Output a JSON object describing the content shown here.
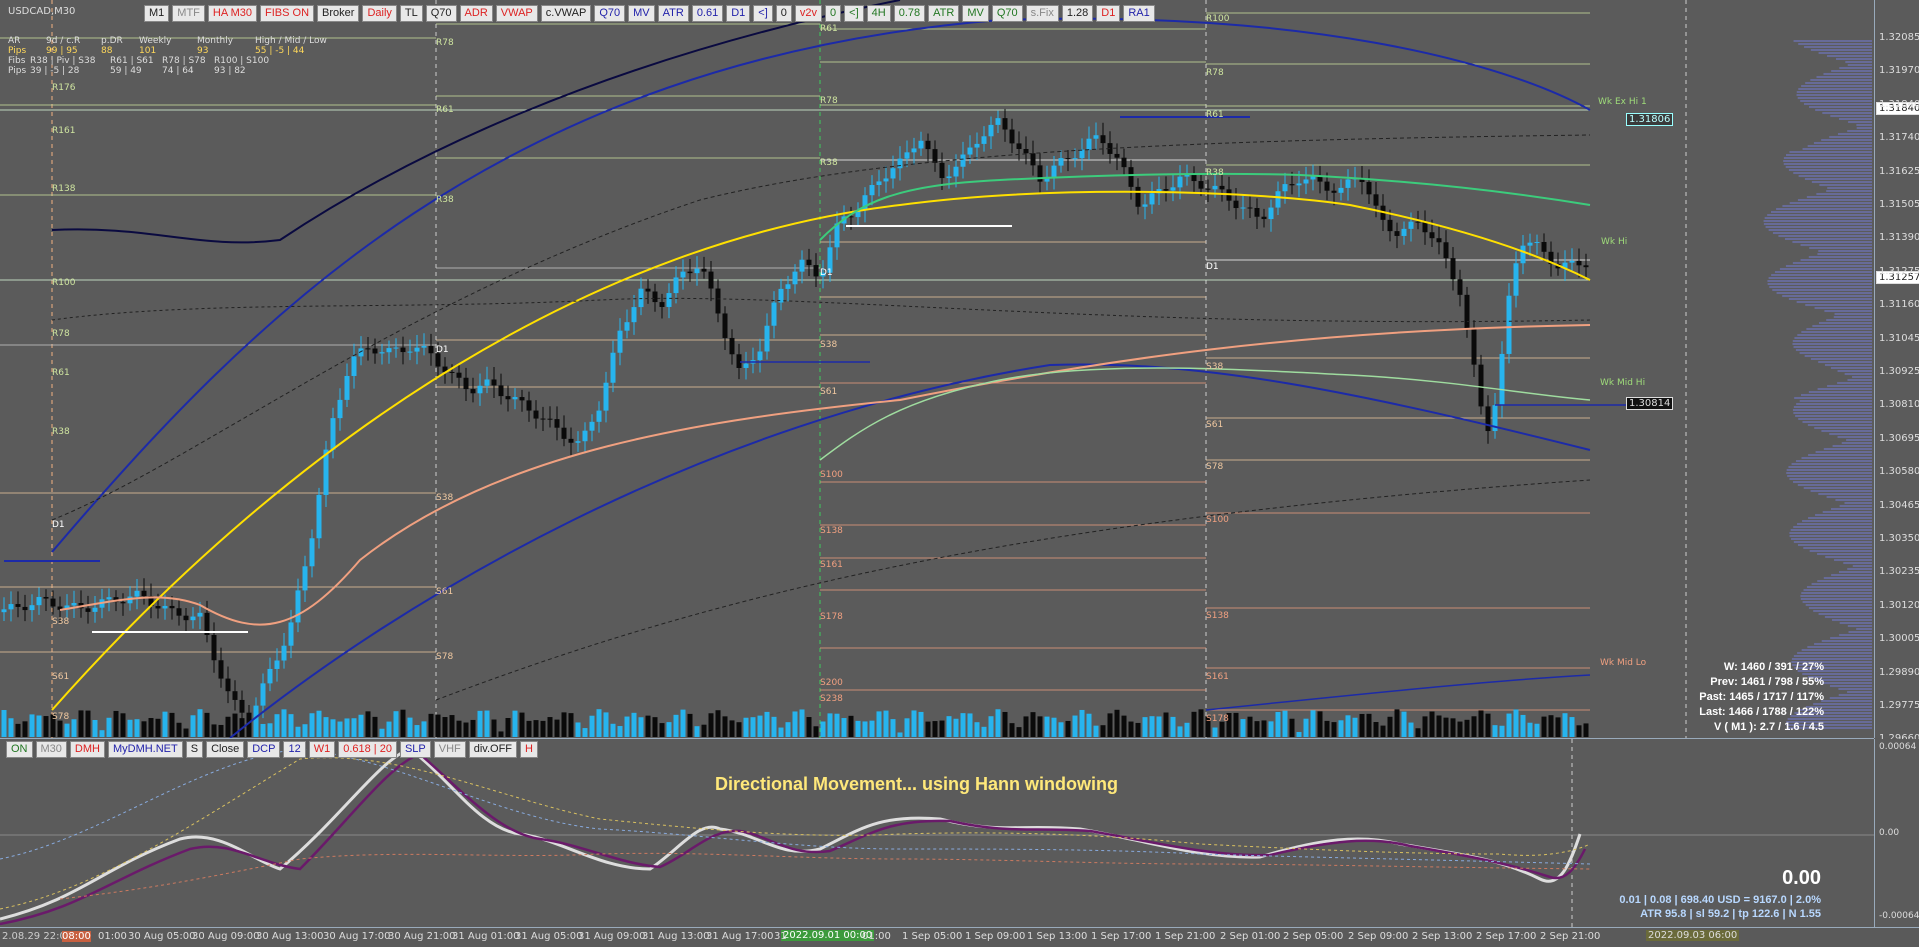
{
  "symbol": "USDCAD,M30",
  "toolbar": [
    {
      "label": "M1",
      "color": "#222"
    },
    {
      "label": "MTF",
      "color": "#888"
    },
    {
      "label": "HA M30",
      "color": "#d22"
    },
    {
      "label": "FIBS ON",
      "color": "#d22"
    },
    {
      "label": "Broker",
      "color": "#222"
    },
    {
      "label": "Daily",
      "color": "#d22"
    },
    {
      "label": "TL",
      "color": "#222"
    },
    {
      "label": "Q70",
      "color": "#222"
    },
    {
      "label": "ADR",
      "color": "#d22"
    },
    {
      "label": "VWAP",
      "color": "#d22"
    },
    {
      "label": "c.VWAP",
      "color": "#222"
    },
    {
      "label": "Q70",
      "color": "#22a"
    },
    {
      "label": "MV",
      "color": "#22a"
    },
    {
      "label": "ATR",
      "color": "#22a"
    },
    {
      "label": "0.61",
      "color": "#22a"
    },
    {
      "label": "D1",
      "color": "#22a"
    },
    {
      "label": "<]",
      "color": "#22a"
    },
    {
      "label": "0",
      "color": "#222"
    },
    {
      "label": "v2v",
      "color": "#d22"
    },
    {
      "label": "0",
      "color": "#272"
    },
    {
      "label": "<]",
      "color": "#272"
    },
    {
      "label": "4H",
      "color": "#272"
    },
    {
      "label": "0.78",
      "color": "#272"
    },
    {
      "label": "ATR",
      "color": "#272"
    },
    {
      "label": "MV",
      "color": "#272"
    },
    {
      "label": "Q70",
      "color": "#272"
    },
    {
      "label": "s.Fix",
      "color": "#888"
    },
    {
      "label": "1.28",
      "color": "#222"
    },
    {
      "label": "D1",
      "color": "#d22"
    },
    {
      "label": "RA1",
      "color": "#22a"
    }
  ],
  "toolbar2": [
    {
      "label": "ON",
      "color": "#272"
    },
    {
      "label": "M30",
      "color": "#888"
    },
    {
      "label": "DMH",
      "color": "#d22"
    },
    {
      "label": "MyDMH.NET",
      "color": "#22a"
    },
    {
      "label": "S",
      "color": "#222"
    },
    {
      "label": "Close",
      "color": "#222"
    },
    {
      "label": "DCP",
      "color": "#22a"
    },
    {
      "label": "12",
      "color": "#22a"
    },
    {
      "label": "W1",
      "color": "#d22"
    },
    {
      "label": "0.618 | 20",
      "color": "#d22"
    },
    {
      "label": "SLP",
      "color": "#22a"
    },
    {
      "label": "VHF",
      "color": "#888"
    },
    {
      "label": "div.OFF",
      "color": "#222"
    },
    {
      "label": "H",
      "color": "#d22"
    }
  ],
  "stats": {
    "header": [
      "AR",
      "9d / c.R",
      "p.DR",
      "Weekly",
      "Monthly",
      "High / Mid / Low"
    ],
    "pips_row": [
      "Pips",
      "99 | 95",
      "88",
      "101",
      "93",
      "55 | -5 | 44"
    ],
    "fibs_header": [
      "Fibs",
      "R38 | Piv | S38",
      "R61 | S61",
      "R78 | S78",
      "R100 | S100"
    ],
    "fibs_row": [
      "Pips",
      "39 | -5 | 28",
      "59 | 49",
      "74 | 64",
      "93 | 82"
    ]
  },
  "price_ticks": [
    "1.32085",
    "1.31970",
    "1.31840",
    "1.31740",
    "1.31625",
    "1.31505",
    "1.31390",
    "1.31275",
    "1.31160",
    "1.31045",
    "1.30925",
    "1.30810",
    "1.30695",
    "1.30580",
    "1.30465",
    "1.30350",
    "1.30235",
    "1.30120",
    "1.30005",
    "1.29890",
    "1.29775",
    "1.29660"
  ],
  "price_tags": {
    "upper": "1.31840",
    "current": "1.31257",
    "marker1": "1.31806",
    "marker2": "1.30814"
  },
  "level_labels": [
    {
      "t": "R78",
      "c": "#cfe5a0"
    },
    {
      "t": "R61",
      "c": "#cfe5a0"
    },
    {
      "t": "R38",
      "c": "#cfe5a0"
    },
    {
      "t": "D1",
      "c": "#fff"
    },
    {
      "t": "S38",
      "c": "#f0c8a0"
    },
    {
      "t": "S61",
      "c": "#f0c8a0"
    },
    {
      "t": "S78",
      "c": "#f0c8a0"
    },
    {
      "t": "R100",
      "c": "#cfe5a0"
    },
    {
      "t": "S100",
      "c": "#f0a080"
    },
    {
      "t": "S138",
      "c": "#f0a080"
    },
    {
      "t": "S161",
      "c": "#f0a080"
    },
    {
      "t": "S178",
      "c": "#f0a080"
    },
    {
      "t": "S200",
      "c": "#f0a080"
    },
    {
      "t": "S238",
      "c": "#f0a080"
    },
    {
      "t": "R138",
      "c": "#cfe5a0"
    },
    {
      "t": "R161",
      "c": "#cfe5a0"
    },
    {
      "t": "R176",
      "c": "#cfe5a0"
    }
  ],
  "wk_labels": {
    "ex_hi": "Wk Ex Hi 1",
    "hi": "Wk Hi",
    "mid_hi": "Wk Mid Hi",
    "mid_lo": "Wk Mid Lo"
  },
  "overlay": {
    "w": "W: 1460 / 391 / 27%",
    "prev": "Prev: 1461 / 798 / 55%",
    "past": "Past: 1465 / 1717 / 117%",
    "last": "Last: 1466 / 1788 / 122%",
    "v": "V ( M1 ): 2.7 / 1.6 / 4.5"
  },
  "sub": {
    "title": "Directional Movement... using Hann windowing",
    "big_value": "0.00",
    "info1": "0.01  |  0.08  |  698.40 USD = 9167.0  |  2.0%",
    "info2": "ATR 95.8  |  sl 59.2  |  tp 122.6  |  N 1.55",
    "ticks": [
      "0.00064",
      "0.00",
      "-0.00064"
    ]
  },
  "time_labels": [
    "2.08.29 22:00",
    "08:00",
    "01:00",
    "30 Aug 05:00",
    "30 Aug 09:00",
    "30 Aug 13:00",
    "30 Aug 17:00",
    "30 Aug 21:00",
    "31 Aug 01:00",
    "31 Aug 05:00",
    "31 Aug 09:00",
    "31 Aug 13:00",
    "31 Aug 17:00",
    "31",
    "01:00",
    "1 Sep 05:00",
    "1 Sep 09:00",
    "1 Sep 13:00",
    "1 Sep 17:00",
    "1 Sep 21:00",
    "2 Sep 01:00",
    "2 Sep 05:00",
    "2 Sep 09:00",
    "2 Sep 13:00",
    "2 Sep 17:00",
    "2 Sep 21:00"
  ],
  "time_highlights": {
    "mid": "2022.09.01 00:00",
    "right": "2022.09.03 06:00"
  }
}
